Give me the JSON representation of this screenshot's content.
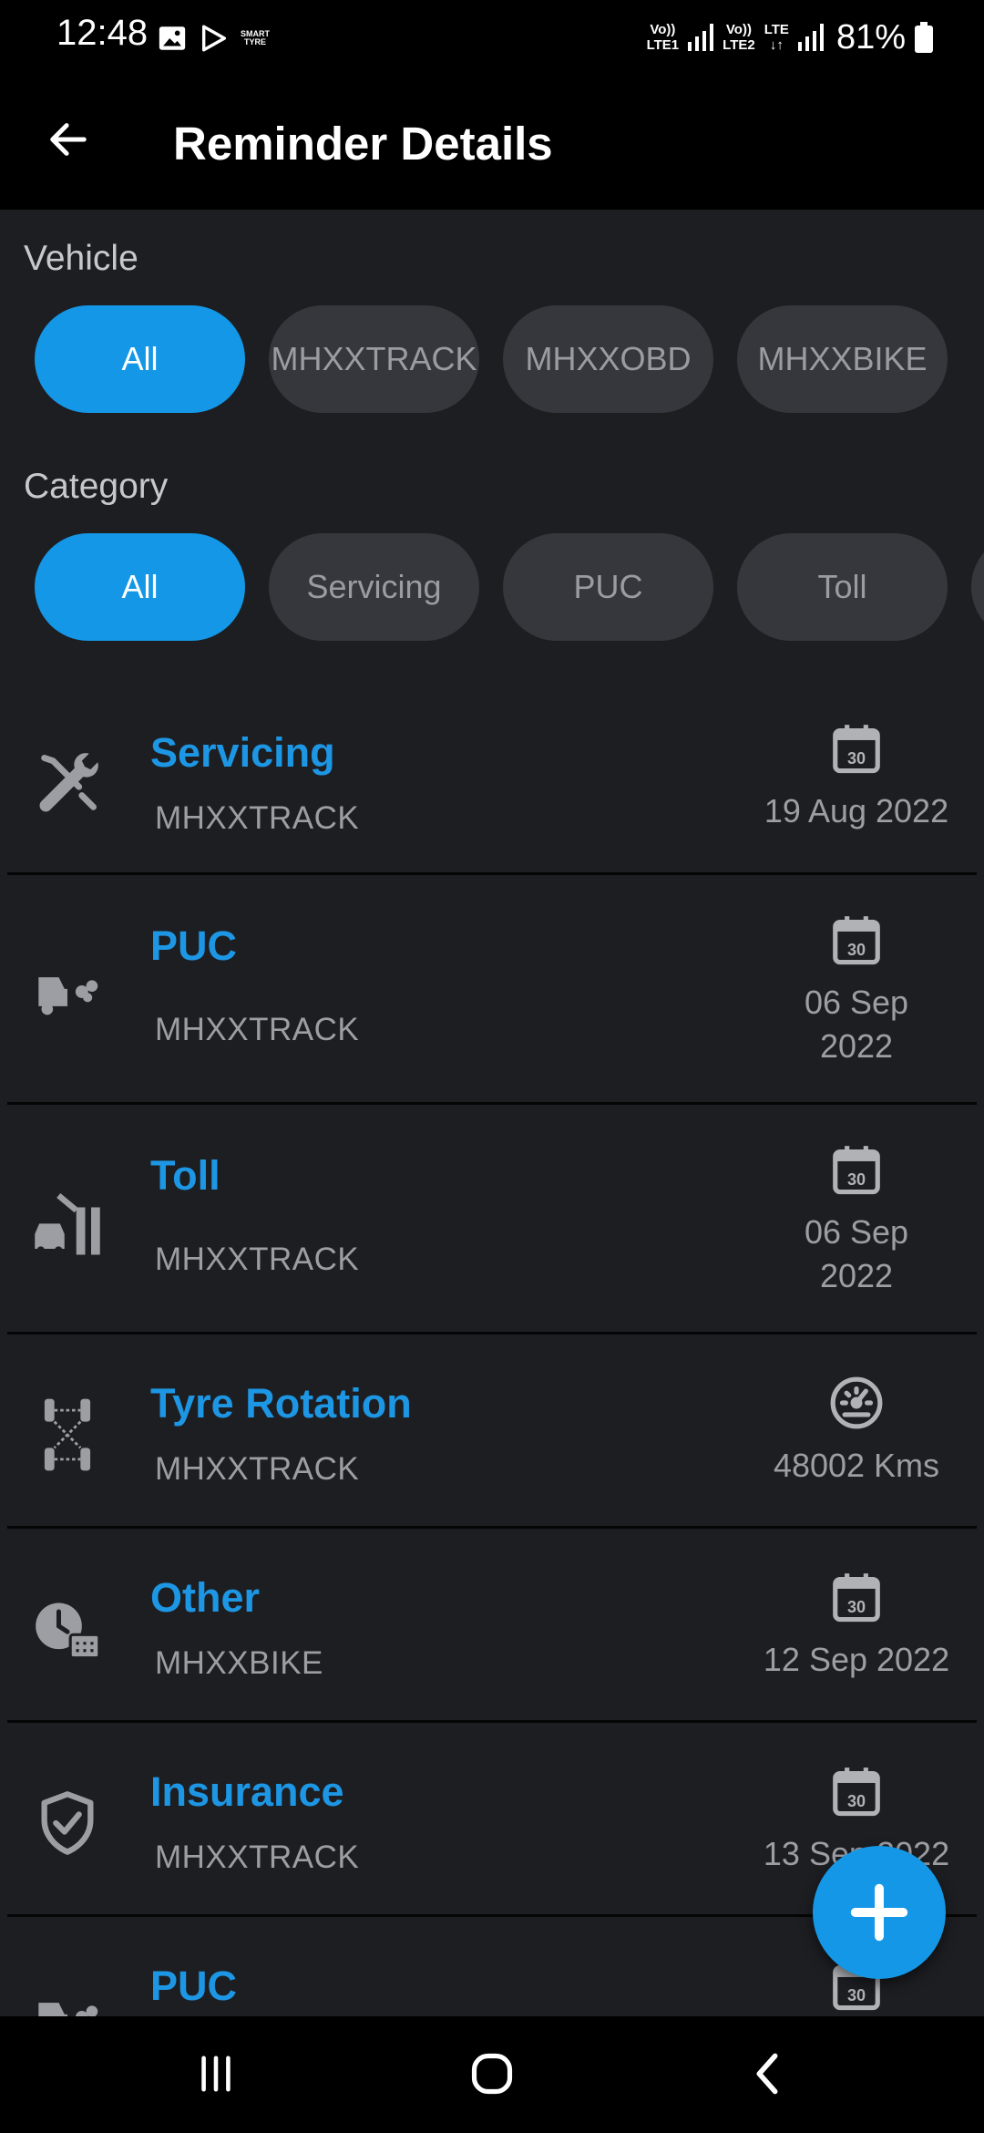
{
  "status_bar": {
    "time": "12:48",
    "carrier_small": "SMART TYRE",
    "sim1": [
      "Vo))",
      "LTE1"
    ],
    "sim2": [
      "Vo))",
      "LTE2"
    ],
    "lte": "LTE",
    "battery": "81%"
  },
  "app_bar": {
    "title": "Reminder Details"
  },
  "filters": {
    "vehicle_label": "Vehicle",
    "vehicles": [
      {
        "label": "All",
        "active": true
      },
      {
        "label": "MHXXTRACK",
        "active": false
      },
      {
        "label": "MHXXOBD",
        "active": false
      },
      {
        "label": "MHXXBIKE",
        "active": false
      }
    ],
    "category_label": "Category",
    "categories": [
      {
        "label": "All",
        "active": true
      },
      {
        "label": "Servicing",
        "active": false
      },
      {
        "label": "PUC",
        "active": false
      },
      {
        "label": "Toll",
        "active": false
      }
    ]
  },
  "reminders": [
    {
      "title": "Servicing",
      "vehicle": "MHXXTRACK",
      "date_line1": "19 Aug 2022",
      "date_line2": "",
      "icon": "wrench-screwdriver-icon",
      "right_icon": "calendar-icon",
      "calendar_day": "30"
    },
    {
      "title": "PUC",
      "vehicle": "MHXXTRACK",
      "date_line1": "06 Sep",
      "date_line2": "2022",
      "icon": "car-exhaust-icon",
      "right_icon": "calendar-icon",
      "calendar_day": "30"
    },
    {
      "title": "Toll",
      "vehicle": "MHXXTRACK",
      "date_line1": "06 Sep",
      "date_line2": "2022",
      "icon": "toll-gate-icon",
      "right_icon": "calendar-icon",
      "calendar_day": "30"
    },
    {
      "title": "Tyre Rotation",
      "vehicle": "MHXXTRACK",
      "date_line1": "48002 Kms",
      "date_line2": "",
      "icon": "tyre-rotation-icon",
      "right_icon": "speedometer-icon",
      "calendar_day": ""
    },
    {
      "title": "Other",
      "vehicle": "MHXXBIKE",
      "date_line1": "12 Sep 2022",
      "date_line2": "",
      "icon": "clock-calendar-icon",
      "right_icon": "calendar-icon",
      "calendar_day": "30"
    },
    {
      "title": "Insurance",
      "vehicle": "MHXXTRACK",
      "date_line1": "13 Sep 2022",
      "date_line2": "",
      "icon": "shield-check-icon",
      "right_icon": "calendar-icon",
      "calendar_day": "30"
    },
    {
      "title": "PUC",
      "vehicle": "",
      "date_line1": "",
      "date_line2": "",
      "icon": "car-exhaust-icon",
      "right_icon": "calendar-icon",
      "calendar_day": "30"
    }
  ],
  "colors": {
    "accent": "#1497e6",
    "background": "#1d1e22",
    "chip_inactive": "#35373c"
  }
}
